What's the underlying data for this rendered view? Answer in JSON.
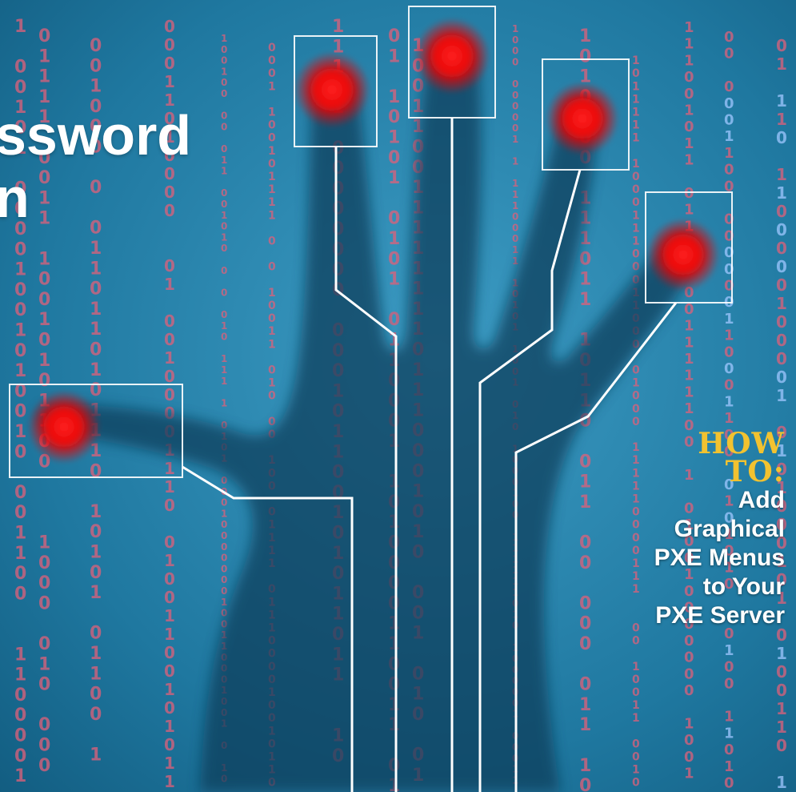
{
  "headline": {
    "line1": "ssword",
    "line2": "n"
  },
  "howto": {
    "kicker_line1": "HOW",
    "kicker_line2": "TO:",
    "sub_lines": [
      "Add",
      "Graphical",
      "PXE Menus",
      "to Your",
      "PXE Server"
    ]
  },
  "theme": {
    "background": "#1b6f95",
    "accent": "#f2c230",
    "glow": "#ff1010",
    "digit_color": "#e0607a"
  }
}
